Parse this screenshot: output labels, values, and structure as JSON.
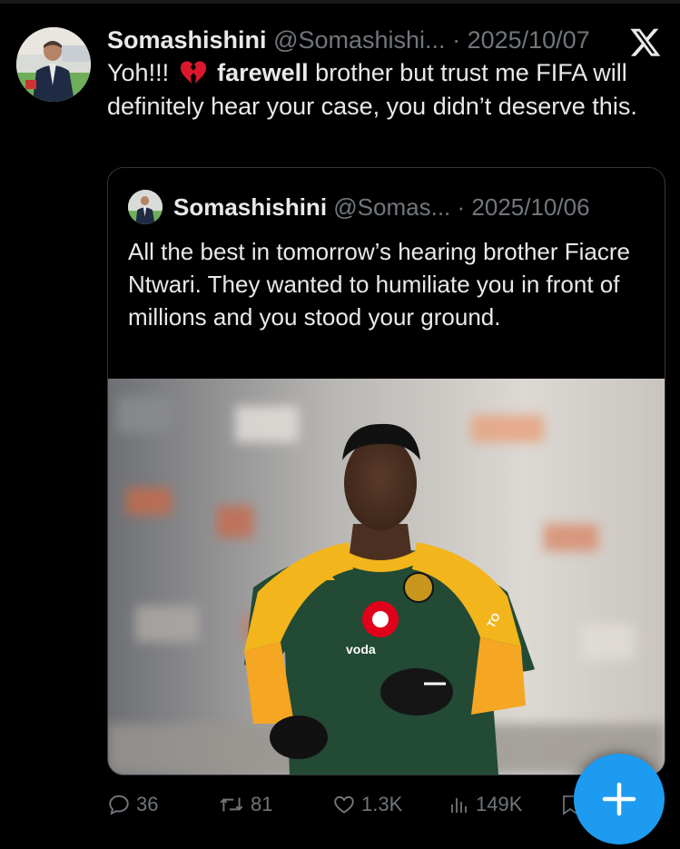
{
  "tweet": {
    "display_name": "Somashishini",
    "handle": "@Somashishi...",
    "separator": "·",
    "date": "2025/10/07",
    "text_before_emoji": "Yoh!!!",
    "emoji": "broken-heart",
    "text_bold": "farewell",
    "text_after": " brother but trust me FIFA will definitely hear your case, you didn’t deserve this."
  },
  "quoted_tweet": {
    "display_name": "Somashishini",
    "handle": "@Somas...",
    "separator": "·",
    "date": "2025/10/06",
    "text": "All the best in tomorrow’s hearing brother Fiacre Ntwari. They wanted to humiliate you in front of millions and you stood your ground.",
    "image": {
      "description_icon": "goalkeeper-photo",
      "sponsor_text": "voda",
      "kit_brand_text": "TO"
    }
  },
  "actions": {
    "replies": "36",
    "retweets": "81",
    "likes": "1.3K",
    "views": "149K"
  },
  "colors": {
    "background": "#000000",
    "text": "#e7e9ea",
    "muted": "#71767b",
    "accent": "#1d9bf0",
    "border": "#333639"
  }
}
